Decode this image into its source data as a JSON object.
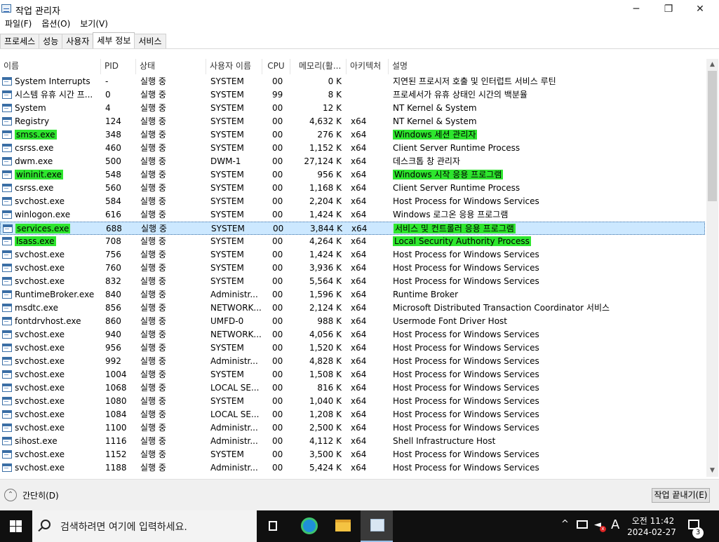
{
  "window": {
    "title": "작업 관리자",
    "minimize": "─",
    "maximize": "❐",
    "close": "✕"
  },
  "menu": [
    "파일(F)",
    "옵션(O)",
    "보기(V)"
  ],
  "tabs": [
    {
      "label": "프로세스",
      "active": false
    },
    {
      "label": "성능",
      "active": false
    },
    {
      "label": "사용자",
      "active": false
    },
    {
      "label": "세부 정보",
      "active": true
    },
    {
      "label": "서비스",
      "active": false
    }
  ],
  "columns": {
    "name": "이름",
    "pid": "PID",
    "status": "상태",
    "user": "사용자 이름",
    "cpu": "CPU",
    "memory": "메모리(활...",
    "arch": "아키텍처",
    "desc": "설명"
  },
  "sort_indicator": "^",
  "highlight_color": "#2ee62e",
  "rows": [
    {
      "name": "System Interrupts",
      "pid": "-",
      "status": "실행 중",
      "user": "SYSTEM",
      "cpu": "00",
      "mem": "0 K",
      "arch": "",
      "desc": "지연된 프로시저 호출 및 인터럽트 서비스 루틴"
    },
    {
      "name": "시스템 유휴 시간 프...",
      "pid": "0",
      "status": "실행 중",
      "user": "SYSTEM",
      "cpu": "99",
      "mem": "8 K",
      "arch": "",
      "desc": "프로세서가 유휴 상태인 시간의 백분율"
    },
    {
      "name": "System",
      "pid": "4",
      "status": "실행 중",
      "user": "SYSTEM",
      "cpu": "00",
      "mem": "12 K",
      "arch": "",
      "desc": "NT Kernel & System"
    },
    {
      "name": "Registry",
      "pid": "124",
      "status": "실행 중",
      "user": "SYSTEM",
      "cpu": "00",
      "mem": "4,632 K",
      "arch": "x64",
      "desc": "NT Kernel & System"
    },
    {
      "name": "smss.exe",
      "pid": "348",
      "status": "실행 중",
      "user": "SYSTEM",
      "cpu": "00",
      "mem": "276 K",
      "arch": "x64",
      "desc": "Windows 세션 관리자",
      "highlight": true
    },
    {
      "name": "csrss.exe",
      "pid": "460",
      "status": "실행 중",
      "user": "SYSTEM",
      "cpu": "00",
      "mem": "1,152 K",
      "arch": "x64",
      "desc": "Client Server Runtime Process"
    },
    {
      "name": "dwm.exe",
      "pid": "500",
      "status": "실행 중",
      "user": "DWM-1",
      "cpu": "00",
      "mem": "27,124 K",
      "arch": "x64",
      "desc": "데스크톱 창 관리자"
    },
    {
      "name": "wininit.exe",
      "pid": "548",
      "status": "실행 중",
      "user": "SYSTEM",
      "cpu": "00",
      "mem": "956 K",
      "arch": "x64",
      "desc": "Windows 시작 응용 프로그램",
      "highlight": true
    },
    {
      "name": "csrss.exe",
      "pid": "560",
      "status": "실행 중",
      "user": "SYSTEM",
      "cpu": "00",
      "mem": "1,168 K",
      "arch": "x64",
      "desc": "Client Server Runtime Process"
    },
    {
      "name": "svchost.exe",
      "pid": "584",
      "status": "실행 중",
      "user": "SYSTEM",
      "cpu": "00",
      "mem": "2,204 K",
      "arch": "x64",
      "desc": "Host Process for Windows Services"
    },
    {
      "name": "winlogon.exe",
      "pid": "616",
      "status": "실행 중",
      "user": "SYSTEM",
      "cpu": "00",
      "mem": "1,424 K",
      "arch": "x64",
      "desc": "Windows 로그온 응용 프로그램"
    },
    {
      "name": "services.exe",
      "pid": "688",
      "status": "실행 중",
      "user": "SYSTEM",
      "cpu": "00",
      "mem": "3,844 K",
      "arch": "x64",
      "desc": "서비스 및 컨트롤러 응용 프로그램",
      "highlight": true,
      "selected": true
    },
    {
      "name": "lsass.exe",
      "pid": "708",
      "status": "실행 중",
      "user": "SYSTEM",
      "cpu": "00",
      "mem": "4,264 K",
      "arch": "x64",
      "desc": "Local Security Authority Process",
      "highlight": true
    },
    {
      "name": "svchost.exe",
      "pid": "756",
      "status": "실행 중",
      "user": "SYSTEM",
      "cpu": "00",
      "mem": "1,424 K",
      "arch": "x64",
      "desc": "Host Process for Windows Services"
    },
    {
      "name": "svchost.exe",
      "pid": "760",
      "status": "실행 중",
      "user": "SYSTEM",
      "cpu": "00",
      "mem": "3,936 K",
      "arch": "x64",
      "desc": "Host Process for Windows Services"
    },
    {
      "name": "svchost.exe",
      "pid": "832",
      "status": "실행 중",
      "user": "SYSTEM",
      "cpu": "00",
      "mem": "5,564 K",
      "arch": "x64",
      "desc": "Host Process for Windows Services"
    },
    {
      "name": "RuntimeBroker.exe",
      "pid": "840",
      "status": "실행 중",
      "user": "Administr...",
      "cpu": "00",
      "mem": "1,596 K",
      "arch": "x64",
      "desc": "Runtime Broker"
    },
    {
      "name": "msdtc.exe",
      "pid": "856",
      "status": "실행 중",
      "user": "NETWORK...",
      "cpu": "00",
      "mem": "2,124 K",
      "arch": "x64",
      "desc": "Microsoft Distributed Transaction Coordinator 서비스"
    },
    {
      "name": "fontdrvhost.exe",
      "pid": "860",
      "status": "실행 중",
      "user": "UMFD-0",
      "cpu": "00",
      "mem": "988 K",
      "arch": "x64",
      "desc": "Usermode Font Driver Host"
    },
    {
      "name": "svchost.exe",
      "pid": "940",
      "status": "실행 중",
      "user": "NETWORK...",
      "cpu": "00",
      "mem": "4,056 K",
      "arch": "x64",
      "desc": "Host Process for Windows Services"
    },
    {
      "name": "svchost.exe",
      "pid": "956",
      "status": "실행 중",
      "user": "SYSTEM",
      "cpu": "00",
      "mem": "1,520 K",
      "arch": "x64",
      "desc": "Host Process for Windows Services"
    },
    {
      "name": "svchost.exe",
      "pid": "992",
      "status": "실행 중",
      "user": "Administr...",
      "cpu": "00",
      "mem": "4,828 K",
      "arch": "x64",
      "desc": "Host Process for Windows Services"
    },
    {
      "name": "svchost.exe",
      "pid": "1004",
      "status": "실행 중",
      "user": "SYSTEM",
      "cpu": "00",
      "mem": "1,508 K",
      "arch": "x64",
      "desc": "Host Process for Windows Services"
    },
    {
      "name": "svchost.exe",
      "pid": "1068",
      "status": "실행 중",
      "user": "LOCAL SE...",
      "cpu": "00",
      "mem": "816 K",
      "arch": "x64",
      "desc": "Host Process for Windows Services"
    },
    {
      "name": "svchost.exe",
      "pid": "1080",
      "status": "실행 중",
      "user": "SYSTEM",
      "cpu": "00",
      "mem": "1,040 K",
      "arch": "x64",
      "desc": "Host Process for Windows Services"
    },
    {
      "name": "svchost.exe",
      "pid": "1084",
      "status": "실행 중",
      "user": "LOCAL SE...",
      "cpu": "00",
      "mem": "1,208 K",
      "arch": "x64",
      "desc": "Host Process for Windows Services"
    },
    {
      "name": "svchost.exe",
      "pid": "1100",
      "status": "실행 중",
      "user": "Administr...",
      "cpu": "00",
      "mem": "2,500 K",
      "arch": "x64",
      "desc": "Host Process for Windows Services"
    },
    {
      "name": "sihost.exe",
      "pid": "1116",
      "status": "실행 중",
      "user": "Administr...",
      "cpu": "00",
      "mem": "4,112 K",
      "arch": "x64",
      "desc": "Shell Infrastructure Host"
    },
    {
      "name": "svchost.exe",
      "pid": "1152",
      "status": "실행 중",
      "user": "SYSTEM",
      "cpu": "00",
      "mem": "3,500 K",
      "arch": "x64",
      "desc": "Host Process for Windows Services"
    },
    {
      "name": "svchost.exe",
      "pid": "1188",
      "status": "실행 중",
      "user": "Administr...",
      "cpu": "00",
      "mem": "5,424 K",
      "arch": "x64",
      "desc": "Host Process for Windows Services"
    }
  ],
  "footer": {
    "collapse_label": "간단히(D)",
    "end_task_label": "작업 끝내기(E)"
  },
  "taskbar": {
    "search_placeholder": "검색하려면 여기에 입력하세요.",
    "ime": "A",
    "time": "오전 11:42",
    "date": "2024-02-27",
    "notification_count": "3"
  }
}
